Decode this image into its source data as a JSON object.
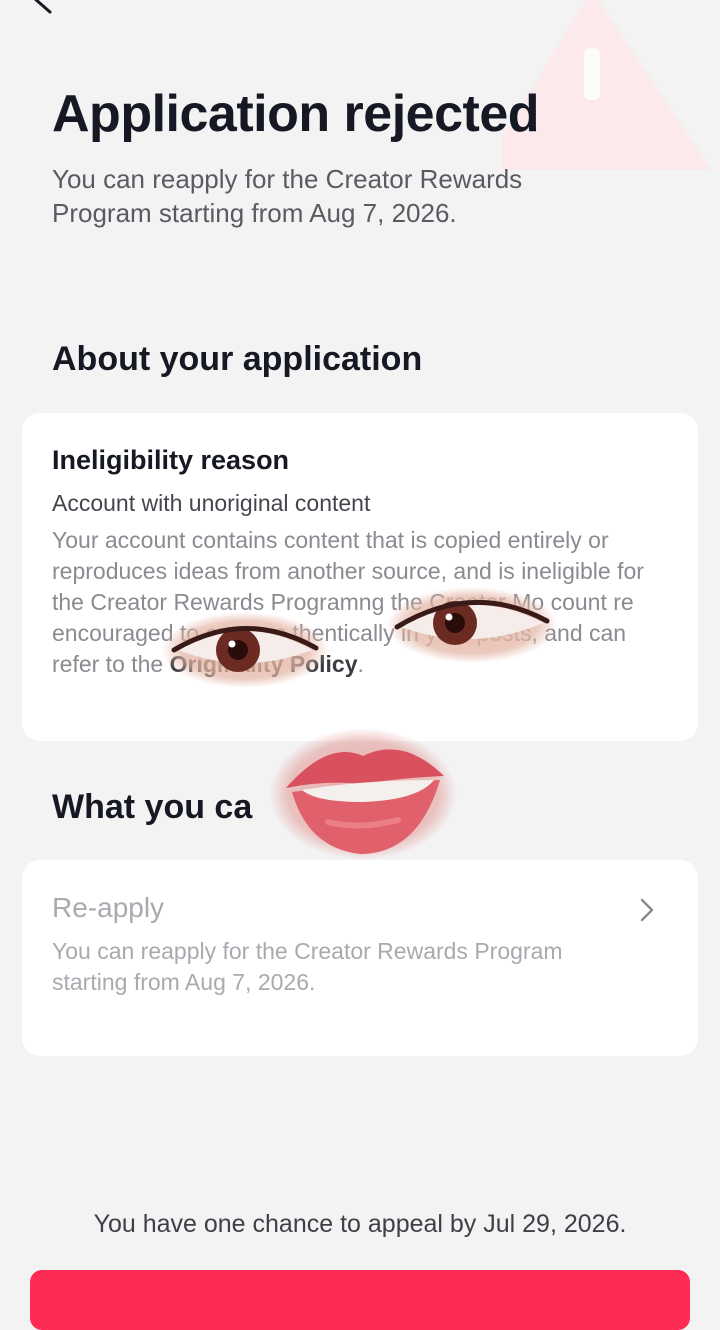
{
  "header": {
    "back_icon": "chevron-left-icon",
    "warning_icon": "warning-triangle-icon"
  },
  "status": {
    "title": "Application rejected",
    "subtitle": "You can reapply for the Creator Rewards Program starting from Aug 7, 2026."
  },
  "about": {
    "heading": "About your application",
    "card": {
      "title": "Ineligibility reason",
      "reason": "Account with unoriginal content",
      "body_visible": "Your account contains content that is copied entirely or reproduces ideas from another source, and is ineligible for the Creator Rewards Program",
      "body_fragment_1": "ng the",
      "body_fragment_2": "Creator Mo",
      "body_fragment_3": "count",
      "body_fragment_4": "re encouraged",
      "body_fragment_5": "to express",
      "body_fragment_6": "thentically in your posts, and can",
      "body_fragment_7": "refer to the",
      "policy_link": "Originality Policy",
      "body_end": "."
    }
  },
  "actions": {
    "heading": "What you ca",
    "reapply": {
      "title": "Re-apply",
      "description": "You can reapply for the Creator Rewards Program starting from Aug 7, 2026.",
      "chevron_icon": "chevron-right-icon"
    }
  },
  "footer": {
    "appeal_note": "You have one chance to appeal by Jul 29, 2026.",
    "button_color": "#fe2c55"
  },
  "overlays": {
    "sticker_1": "eye-sticker",
    "sticker_2": "eye-sticker",
    "sticker_3": "lips-sticker"
  }
}
